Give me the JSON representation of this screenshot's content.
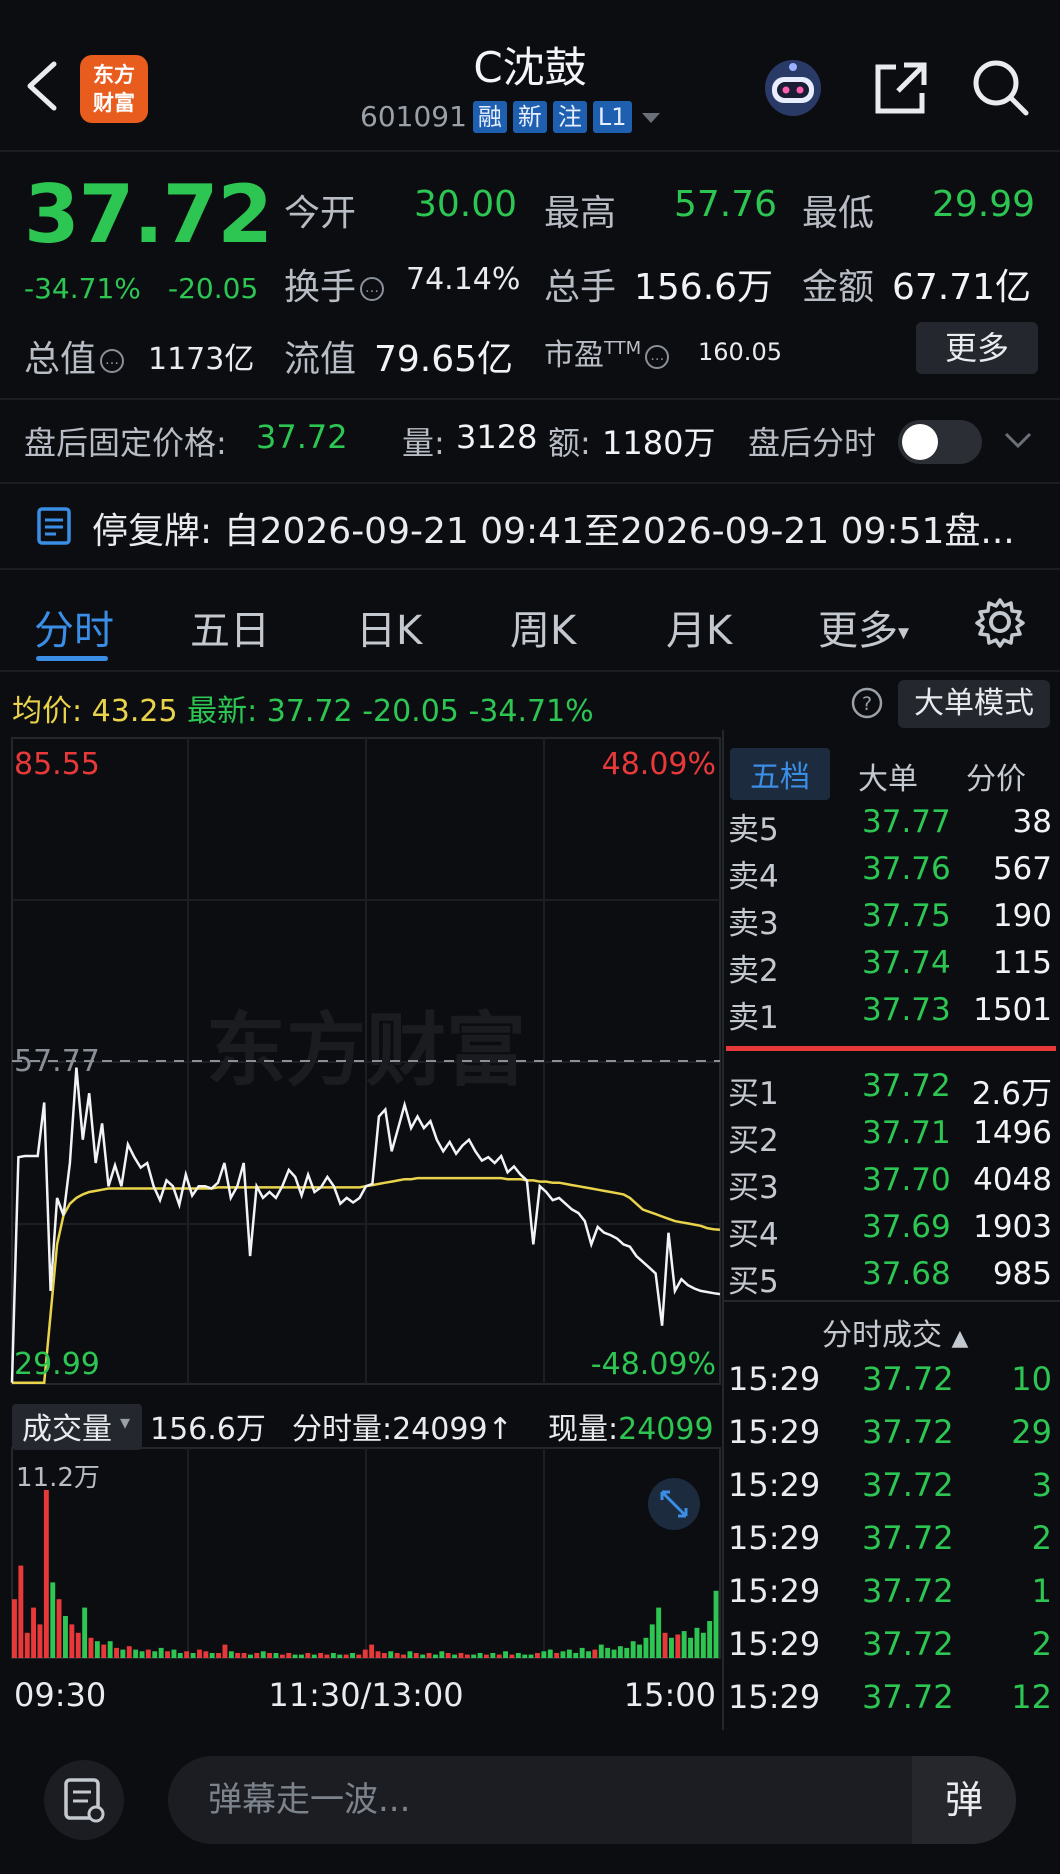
{
  "header": {
    "logo_text_line1": "东方",
    "logo_text_line2": "财富",
    "title": "C沈鼓",
    "code": "601091",
    "tags": [
      "融",
      "新",
      "注",
      "L1"
    ]
  },
  "quote": {
    "price": "37.72",
    "change_pct": "-34.71%",
    "change": "-20.05",
    "open_label": "今开",
    "open": "30.00",
    "high_label": "最高",
    "high": "57.76",
    "low_label": "最低",
    "low": "29.99",
    "turnover_label": "换手",
    "turnover": "74.14%",
    "volume_label": "总手",
    "volume": "156.6万",
    "amount_label": "金额",
    "amount": "67.71亿",
    "mktcap_label": "总值",
    "mktcap": "1173亿",
    "float_label": "流值",
    "float_cap": "79.65亿",
    "pe_label": "市盈",
    "pe_sup": "TTM",
    "pe": "160.05",
    "more_button": "更多"
  },
  "after_hours": {
    "fixed_price_label": "盘后固定价格:",
    "fixed_price": "37.72",
    "vol_label": "量:",
    "vol": "3128",
    "amt_label": "额:",
    "amt": "1180万",
    "intraday_label": "盘后分时"
  },
  "notice": {
    "text": "停复牌:  自2026-09-21 09:41至2026-09-21 09:51盘..."
  },
  "tabs": [
    "分时",
    "五日",
    "日K",
    "周K",
    "月K",
    "更多"
  ],
  "avg_row": {
    "avg_label": "均价:",
    "avg": "43.25",
    "latest_label": "最新:",
    "latest": "37.72",
    "change": "-20.05",
    "change_pct": "-34.71%",
    "big_order_button": "大单模式"
  },
  "chart": {
    "price_max": "85.55",
    "price_min": "29.99",
    "pct_max": "48.09%",
    "pct_min": "-48.09%",
    "prev_close": "57.77",
    "watermark": "东方财富",
    "price_series": [
      30.1,
      49.5,
      49.6,
      49.6,
      49.6,
      54.2,
      38.0,
      46.0,
      44.5,
      49.0,
      57.2,
      51.0,
      55.0,
      49.0,
      52.4,
      47.0,
      48.8,
      47.0,
      50.6,
      49.5,
      48.6,
      49.0,
      47.0,
      45.8,
      47.5,
      47.0,
      45.4,
      48.0,
      46.2,
      47.0,
      47.0,
      46.8,
      47.3,
      49.0,
      46.0,
      47.0,
      49.0,
      41.0,
      47.0,
      46.0,
      46.5,
      46.0,
      47.0,
      48.4,
      47.8,
      46.2,
      48.0,
      46.5,
      46.9,
      47.8,
      47.0,
      45.5,
      46.0,
      45.6,
      46.0,
      47.0,
      47.2,
      53.0,
      53.6,
      50.0,
      52.0,
      54.0,
      52.0,
      53.0,
      52.0,
      52.6,
      51.0,
      50.0,
      50.8,
      49.8,
      50.5,
      51.0,
      50.0,
      49.2,
      49.5,
      49.0,
      49.6,
      48.2,
      48.7,
      48.0,
      47.5,
      42.0,
      47.0,
      46.5,
      45.8,
      46.0,
      45.5,
      45.0,
      44.7,
      44.0,
      42.0,
      43.5,
      43.0,
      42.8,
      42.5,
      42.0,
      41.8,
      41.0,
      40.5,
      40.0,
      39.5,
      35.0,
      43.0,
      38.0,
      39.0,
      38.5,
      38.2,
      38.0,
      37.9,
      37.8,
      37.72
    ],
    "avg_series": [
      30.1,
      30.1,
      30.1,
      30.1,
      30.1,
      30.1,
      36.0,
      42.0,
      44.5,
      45.5,
      46.0,
      46.3,
      46.5,
      46.6,
      46.7,
      46.8,
      46.8,
      46.8,
      46.8,
      46.8,
      46.8,
      46.8,
      46.8,
      46.8,
      46.8,
      46.8,
      46.8,
      46.8,
      46.8,
      46.8,
      46.8,
      46.8,
      46.9,
      46.9,
      46.9,
      46.9,
      46.9,
      46.9,
      46.9,
      46.9,
      46.9,
      46.9,
      46.9,
      46.9,
      46.9,
      46.9,
      46.9,
      46.9,
      46.9,
      46.9,
      46.9,
      46.9,
      46.9,
      46.9,
      46.9,
      47.0,
      47.1,
      47.2,
      47.3,
      47.4,
      47.5,
      47.6,
      47.6,
      47.7,
      47.7,
      47.7,
      47.7,
      47.7,
      47.7,
      47.7,
      47.7,
      47.7,
      47.7,
      47.7,
      47.7,
      47.7,
      47.7,
      47.6,
      47.6,
      47.6,
      47.5,
      47.5,
      47.4,
      47.4,
      47.3,
      47.3,
      47.2,
      47.1,
      47.0,
      46.9,
      46.8,
      46.7,
      46.6,
      46.5,
      46.4,
      46.3,
      46.0,
      45.5,
      45.0,
      44.8,
      44.6,
      44.4,
      44.2,
      44.0,
      43.9,
      43.8,
      43.7,
      43.6,
      43.4,
      43.3,
      43.25
    ],
    "x_labels": [
      "09:30",
      "11:30/13:00",
      "15:00"
    ]
  },
  "volume_panel": {
    "label": "成交量",
    "total": "156.6万",
    "minute_vol_label": "分时量:",
    "minute_vol": "24099",
    "current_vol_label": "现量:",
    "current_vol": "24099",
    "max_label": "11.2万",
    "bars": [
      0.35,
      0.55,
      0.15,
      0.3,
      0.2,
      1.0,
      0.45,
      0.35,
      0.25,
      0.2,
      0.15,
      0.3,
      0.12,
      0.1,
      0.08,
      0.1,
      0.06,
      0.05,
      0.07,
      0.05,
      0.04,
      0.05,
      0.04,
      0.06,
      0.04,
      0.05,
      0.03,
      0.04,
      0.03,
      0.05,
      0.04,
      0.03,
      0.03,
      0.08,
      0.04,
      0.03,
      0.03,
      0.02,
      0.03,
      0.04,
      0.03,
      0.03,
      0.02,
      0.03,
      0.02,
      0.02,
      0.03,
      0.02,
      0.03,
      0.02,
      0.03,
      0.02,
      0.02,
      0.03,
      0.02,
      0.05,
      0.08,
      0.04,
      0.03,
      0.04,
      0.03,
      0.02,
      0.04,
      0.03,
      0.02,
      0.03,
      0.02,
      0.04,
      0.03,
      0.02,
      0.03,
      0.02,
      0.02,
      0.03,
      0.02,
      0.03,
      0.02,
      0.04,
      0.02,
      0.03,
      0.02,
      0.02,
      0.03,
      0.04,
      0.05,
      0.03,
      0.04,
      0.05,
      0.03,
      0.06,
      0.04,
      0.05,
      0.08,
      0.06,
      0.05,
      0.07,
      0.06,
      0.1,
      0.08,
      0.12,
      0.2,
      0.3,
      0.15,
      0.12,
      0.14,
      0.16,
      0.12,
      0.18,
      0.15,
      0.22,
      0.4
    ]
  },
  "order_book": {
    "tabs": [
      "五档",
      "大单",
      "分价"
    ],
    "asks": [
      {
        "label": "卖5",
        "price": "37.77",
        "vol": "38"
      },
      {
        "label": "卖4",
        "price": "37.76",
        "vol": "567"
      },
      {
        "label": "卖3",
        "price": "37.75",
        "vol": "190"
      },
      {
        "label": "卖2",
        "price": "37.74",
        "vol": "115"
      },
      {
        "label": "卖1",
        "price": "37.73",
        "vol": "1501"
      }
    ],
    "bids": [
      {
        "label": "买1",
        "price": "37.72",
        "vol": "2.6万"
      },
      {
        "label": "买2",
        "price": "37.71",
        "vol": "1496"
      },
      {
        "label": "买3",
        "price": "37.70",
        "vol": "4048"
      },
      {
        "label": "买4",
        "price": "37.69",
        "vol": "1903"
      },
      {
        "label": "买5",
        "price": "37.68",
        "vol": "985"
      }
    ]
  },
  "trades": {
    "header": "分时成交",
    "rows": [
      {
        "time": "15:29",
        "price": "37.72",
        "vol": "10"
      },
      {
        "time": "15:29",
        "price": "37.72",
        "vol": "29"
      },
      {
        "time": "15:29",
        "price": "37.72",
        "vol": "3"
      },
      {
        "time": "15:29",
        "price": "37.72",
        "vol": "2"
      },
      {
        "time": "15:29",
        "price": "37.72",
        "vol": "1"
      },
      {
        "time": "15:29",
        "price": "37.72",
        "vol": "2"
      },
      {
        "time": "15:29",
        "price": "37.72",
        "vol": "12"
      }
    ]
  },
  "bottom": {
    "placeholder": "弹幕走一波...",
    "danmu_button": "弹"
  },
  "colors": {
    "green": "#2dc653",
    "red": "#e8393a",
    "accent": "#3a8ee6",
    "avg_line": "#e9d34b"
  }
}
